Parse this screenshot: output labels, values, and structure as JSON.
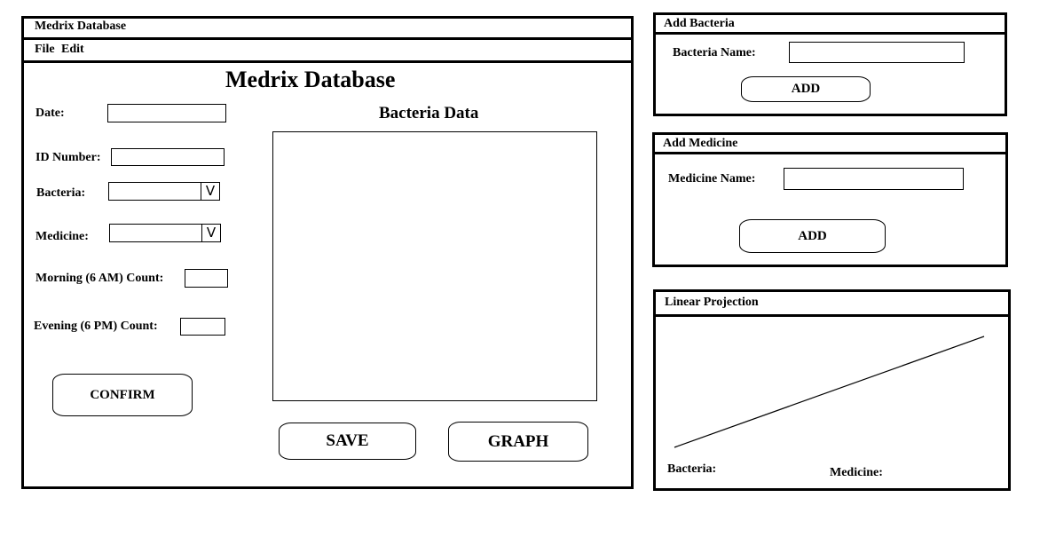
{
  "main_window": {
    "title": "Medrix Database",
    "menu": {
      "file": "File",
      "edit": "Edit"
    },
    "heading": "Medrix Database",
    "fields": {
      "date_label": "Date:",
      "id_label": "ID Number:",
      "bacteria_label": "Bacteria:",
      "medicine_label": "Medicine:",
      "morning_label": "Morning (6 AM) Count:",
      "evening_label": "Evening (6 PM) Count:",
      "dropdown_glyph": "V"
    },
    "confirm_button": "CONFIRM",
    "data_panel": {
      "title": "Bacteria Data"
    },
    "save_button": "SAVE",
    "graph_button": "GRAPH"
  },
  "add_bacteria": {
    "title": "Add Bacteria",
    "name_label": "Bacteria Name:",
    "add_button": "ADD"
  },
  "add_medicine": {
    "title": "Add Medicine",
    "name_label": "Medicine Name:",
    "add_button": "ADD"
  },
  "linear_projection": {
    "title": "Linear Projection",
    "bacteria_label": "Bacteria:",
    "medicine_label": "Medicine:"
  }
}
